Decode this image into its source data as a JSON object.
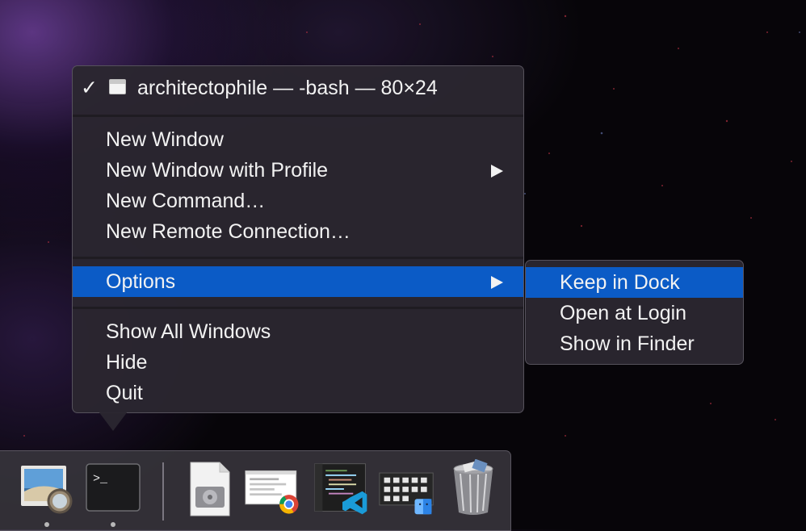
{
  "menu": {
    "title": "architectophile — -bash — 80×24",
    "title_checked": "✓",
    "items": [
      {
        "label": "New Window"
      },
      {
        "label": "New Window with Profile"
      },
      {
        "label": "New Command…"
      },
      {
        "label": "New Remote Connection…"
      },
      {
        "label": "Options"
      },
      {
        "label": "Show All Windows"
      },
      {
        "label": "Hide"
      },
      {
        "label": "Quit"
      }
    ],
    "highlighted_item": "Options"
  },
  "submenu": {
    "items": [
      {
        "label": "Keep in Dock"
      },
      {
        "label": "Open at Login"
      },
      {
        "label": "Show in Finder"
      }
    ],
    "highlighted_item": "Keep in Dock"
  },
  "dock": {
    "apps": [
      {
        "icon": "preview-icon",
        "running": true
      },
      {
        "icon": "terminal-icon",
        "running": true
      },
      {
        "icon": "disk-utility-icon",
        "running": false
      },
      {
        "icon": "chrome-window-icon",
        "running": false
      },
      {
        "icon": "vscode-window-icon",
        "running": false
      },
      {
        "icon": "finder-window-icon",
        "running": false
      },
      {
        "icon": "trash-icon",
        "running": false
      }
    ],
    "terminal_prompt": ">_"
  },
  "colors": {
    "highlight": "#0b5bc6",
    "menu_background": "#2b2730",
    "text": "#f2f2f2"
  }
}
